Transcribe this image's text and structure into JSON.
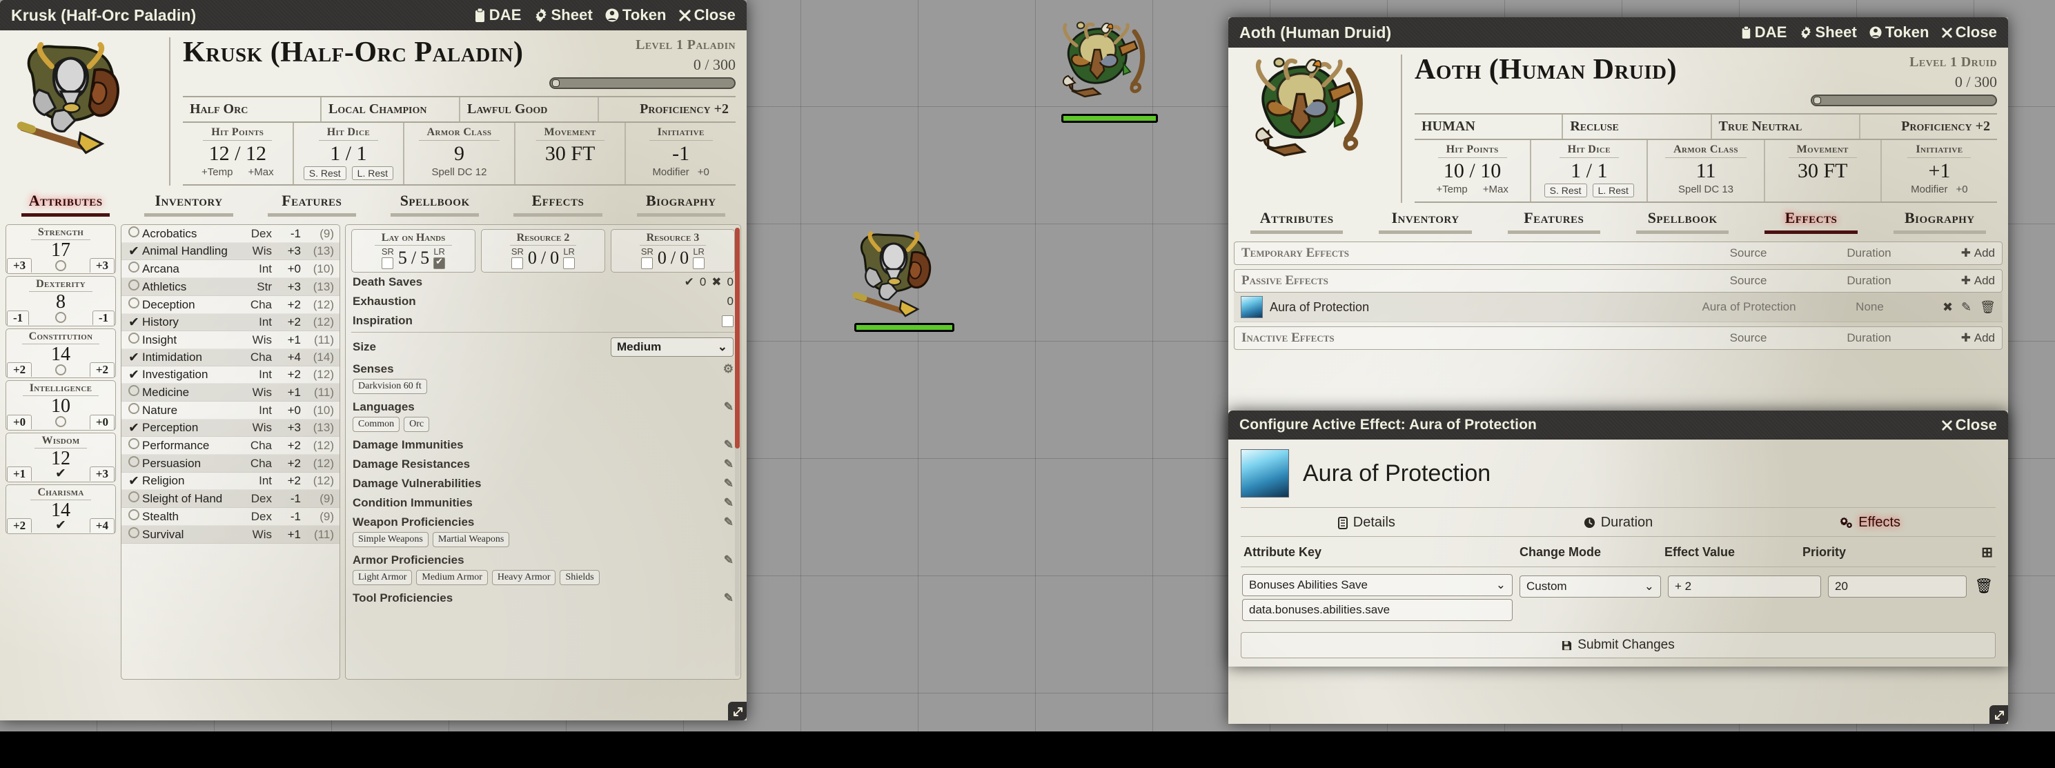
{
  "canvas": {
    "tokens": [
      {
        "name": "druid-token",
        "hp_color": "#5ec72a"
      },
      {
        "name": "paladin-token",
        "hp_color": "#5ec72a"
      }
    ]
  },
  "window_buttons": [
    {
      "icon": "clipboard-icon",
      "label": "DAE"
    },
    {
      "icon": "gear-icon",
      "label": "Sheet"
    },
    {
      "icon": "user-circle-icon",
      "label": "Token"
    },
    {
      "icon": "close-icon",
      "label": "Close"
    }
  ],
  "krusk": {
    "window_title": "Krusk (Half-Orc Paladin)",
    "char_name": "Krusk (Half-Orc Paladin)",
    "level_text": "Level 1 Paladin",
    "xp": "0 / 300",
    "traits": [
      "Half Orc",
      "Local Champion",
      "Lawful Good"
    ],
    "proficiency": "Proficiency +2",
    "stats": [
      {
        "label": "Hit Points",
        "value": "12 / 12",
        "sub_left": "+Temp",
        "sub_right": "+Max"
      },
      {
        "label": "Hit Dice",
        "value": "1 / 1",
        "sub_left": "S. Rest",
        "sub_right": "L. Rest"
      },
      {
        "label": "Armor Class",
        "value": "9",
        "sub": "Spell DC 12"
      },
      {
        "label": "Movement",
        "value": "30 FT",
        "sub": ""
      },
      {
        "label": "Initiative",
        "value": "-1",
        "sub_left": "Modifier",
        "sub_right": "+0"
      }
    ],
    "tabs": [
      {
        "label": "Attributes",
        "active": true
      },
      {
        "label": "Inventory",
        "active": false
      },
      {
        "label": "Features",
        "active": false
      },
      {
        "label": "Spellbook",
        "active": false
      },
      {
        "label": "Effects",
        "active": false
      },
      {
        "label": "Biography",
        "active": false
      }
    ],
    "abilities": [
      {
        "name": "Strength",
        "score": "17",
        "mod": "+3",
        "save": "+3",
        "proficient": false
      },
      {
        "name": "Dexterity",
        "score": "8",
        "mod": "-1",
        "save": "-1",
        "proficient": false
      },
      {
        "name": "Constitution",
        "score": "14",
        "mod": "+2",
        "save": "+2",
        "proficient": false
      },
      {
        "name": "Intelligence",
        "score": "10",
        "mod": "+0",
        "save": "+0",
        "proficient": false
      },
      {
        "name": "Wisdom",
        "score": "12",
        "mod": "+1",
        "save": "+3",
        "proficient": true
      },
      {
        "name": "Charisma",
        "score": "14",
        "mod": "+2",
        "save": "+4",
        "proficient": true
      }
    ],
    "skills": [
      {
        "name": "Acrobatics",
        "ability": "Dex",
        "mod": "-1",
        "passive": "(9)",
        "proficient": false
      },
      {
        "name": "Animal Handling",
        "ability": "Wis",
        "mod": "+3",
        "passive": "(13)",
        "proficient": true
      },
      {
        "name": "Arcana",
        "ability": "Int",
        "mod": "+0",
        "passive": "(10)",
        "proficient": false
      },
      {
        "name": "Athletics",
        "ability": "Str",
        "mod": "+3",
        "passive": "(13)",
        "proficient": false
      },
      {
        "name": "Deception",
        "ability": "Cha",
        "mod": "+2",
        "passive": "(12)",
        "proficient": false
      },
      {
        "name": "History",
        "ability": "Int",
        "mod": "+2",
        "passive": "(12)",
        "proficient": true
      },
      {
        "name": "Insight",
        "ability": "Wis",
        "mod": "+1",
        "passive": "(11)",
        "proficient": false
      },
      {
        "name": "Intimidation",
        "ability": "Cha",
        "mod": "+4",
        "passive": "(14)",
        "proficient": true
      },
      {
        "name": "Investigation",
        "ability": "Int",
        "mod": "+2",
        "passive": "(12)",
        "proficient": true
      },
      {
        "name": "Medicine",
        "ability": "Wis",
        "mod": "+1",
        "passive": "(11)",
        "proficient": false
      },
      {
        "name": "Nature",
        "ability": "Int",
        "mod": "+0",
        "passive": "(10)",
        "proficient": false
      },
      {
        "name": "Perception",
        "ability": "Wis",
        "mod": "+3",
        "passive": "(13)",
        "proficient": true
      },
      {
        "name": "Performance",
        "ability": "Cha",
        "mod": "+2",
        "passive": "(12)",
        "proficient": false
      },
      {
        "name": "Persuasion",
        "ability": "Cha",
        "mod": "+2",
        "passive": "(12)",
        "proficient": false
      },
      {
        "name": "Religion",
        "ability": "Int",
        "mod": "+2",
        "passive": "(12)",
        "proficient": true
      },
      {
        "name": "Sleight of Hand",
        "ability": "Dex",
        "mod": "-1",
        "passive": "(9)",
        "proficient": false
      },
      {
        "name": "Stealth",
        "ability": "Dex",
        "mod": "-1",
        "passive": "(9)",
        "proficient": false
      },
      {
        "name": "Survival",
        "ability": "Wis",
        "mod": "+1",
        "passive": "(11)",
        "proficient": false
      }
    ],
    "resources": [
      {
        "name": "Lay on Hands",
        "value": "5",
        "max": "5",
        "sr": false,
        "lr": true
      },
      {
        "name": "Resource 2",
        "value": "0",
        "max": "0",
        "sr": false,
        "lr": false
      },
      {
        "name": "Resource 3",
        "value": "0",
        "max": "0",
        "sr": false,
        "lr": false
      }
    ],
    "counters": {
      "death_saves_label": "Death Saves",
      "death_success": "0",
      "death_failure": "0",
      "exhaustion_label": "Exhaustion",
      "exhaustion": "0",
      "inspiration_label": "Inspiration"
    },
    "details": {
      "size_label": "Size",
      "size_value": "Medium",
      "senses_label": "Senses",
      "senses": [
        "Darkvision 60 ft"
      ],
      "languages_label": "Languages",
      "languages": [
        "Common",
        "Orc"
      ],
      "damage_immunities_label": "Damage Immunities",
      "damage_resistances_label": "Damage Resistances",
      "damage_vulnerabilities_label": "Damage Vulnerabilities",
      "condition_immunities_label": "Condition Immunities",
      "weapon_prof_label": "Weapon Proficiencies",
      "weapon_profs": [
        "Simple Weapons",
        "Martial Weapons"
      ],
      "armor_prof_label": "Armor Proficiencies",
      "armor_profs": [
        "Light Armor",
        "Medium Armor",
        "Heavy Armor",
        "Shields"
      ],
      "tool_prof_label": "Tool Proficiencies"
    }
  },
  "aoth": {
    "window_title": "Aoth (Human Druid)",
    "char_name": "Aoth (Human Druid)",
    "level_text": "Level 1 Druid",
    "xp": "0 / 300",
    "traits": [
      "HUMAN",
      "Recluse",
      "True Neutral"
    ],
    "proficiency": "Proficiency +2",
    "stats": [
      {
        "label": "Hit Points",
        "value": "10 / 10",
        "sub_left": "+Temp",
        "sub_right": "+Max"
      },
      {
        "label": "Hit Dice",
        "value": "1 / 1",
        "sub_left": "S. Rest",
        "sub_right": "L. Rest"
      },
      {
        "label": "Armor Class",
        "value": "11",
        "sub": "Spell DC 13"
      },
      {
        "label": "Movement",
        "value": "30 FT",
        "sub": ""
      },
      {
        "label": "Initiative",
        "value": "+1",
        "sub_left": "Modifier",
        "sub_right": "+0"
      }
    ],
    "tabs": [
      {
        "label": "Attributes",
        "active": false
      },
      {
        "label": "Inventory",
        "active": false
      },
      {
        "label": "Features",
        "active": false
      },
      {
        "label": "Spellbook",
        "active": false
      },
      {
        "label": "Effects",
        "active": true
      },
      {
        "label": "Biography",
        "active": false
      }
    ],
    "effects": {
      "col_source": "Source",
      "col_duration": "Duration",
      "add_label": "Add",
      "sections": [
        {
          "title": "Temporary Effects",
          "rows": []
        },
        {
          "title": "Passive Effects",
          "rows": [
            {
              "name": "Aura of Protection",
              "source": "Aura of Protection",
              "duration": "None"
            }
          ]
        },
        {
          "title": "Inactive Effects",
          "rows": []
        }
      ]
    }
  },
  "dialog": {
    "window_title": "Configure Active Effect: Aura of Protection",
    "close_label": "Close",
    "effect_name": "Aura of Protection",
    "tabs": [
      {
        "label": "Details",
        "icon": "list-icon",
        "active": false
      },
      {
        "label": "Duration",
        "icon": "clock-icon",
        "active": false
      },
      {
        "label": "Effects",
        "icon": "gears-icon",
        "active": true
      }
    ],
    "columns": {
      "attribute_key": "Attribute Key",
      "change_mode": "Change Mode",
      "effect_value": "Effect Value",
      "priority": "Priority"
    },
    "change": {
      "attribute_key_select": "Bonuses Abilities Save",
      "attribute_key_path": "data.bonuses.abilities.save",
      "change_mode": "Custom",
      "effect_value": "+ 2",
      "priority": "20"
    },
    "submit_label": "Submit Changes"
  }
}
